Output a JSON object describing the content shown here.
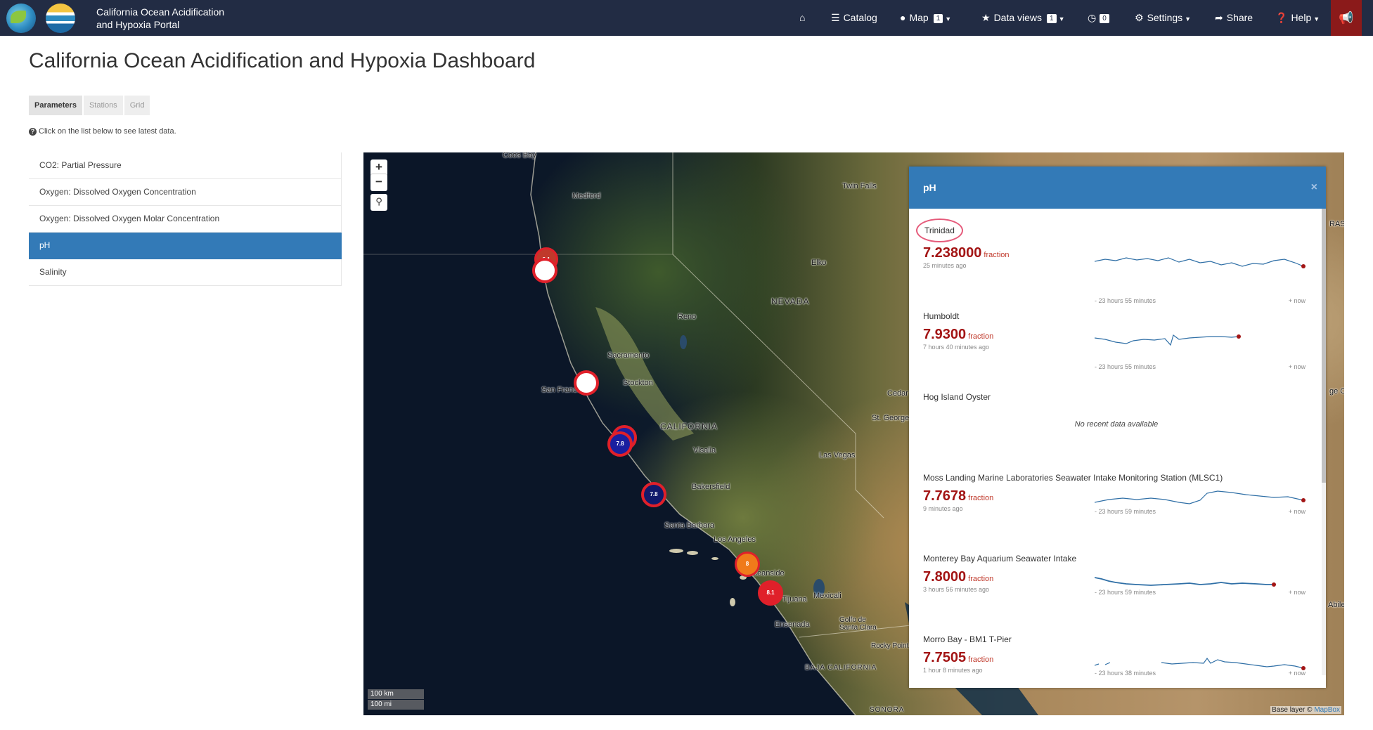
{
  "navbar": {
    "brand_line1": "California Ocean Acidification",
    "brand_line2": "and Hypoxia Portal",
    "catalog": "Catalog",
    "map": "Map",
    "map_count": "1",
    "data_views": "Data views",
    "data_views_count": "1",
    "timeseries_count": "0",
    "settings": "Settings",
    "share": "Share",
    "help": "Help",
    "icons": [
      "home-icon",
      "list-icon",
      "globe-icon",
      "star-icon",
      "clock-icon",
      "gear-icon",
      "share-icon",
      "question-icon",
      "megaphone-icon"
    ]
  },
  "page": {
    "title": "California Ocean Acidification and Hypoxia Dashboard",
    "tabs": [
      "Parameters",
      "Stations",
      "Grid"
    ],
    "hint": "Click on the list below to see latest data."
  },
  "parameters": [
    "CO2: Partial Pressure",
    "Oxygen: Dissolved Oxygen Concentration",
    "Oxygen: Dissolved Oxygen Molar Concentration",
    "pH",
    "Salinity"
  ],
  "map": {
    "places": [
      "Coos Bay",
      "Medford",
      "Twin Falls",
      "Elko",
      "NEVADA",
      "Reno",
      "Sacramento",
      "Stockton",
      "San Francisco",
      "CALIFORNIA",
      "Visalia",
      "Bakersfield",
      "Las Vegas",
      "St. George",
      "Santa Barbara",
      "Los Angeles",
      "Oceanside",
      "Tijuana",
      "Mexicali",
      "Ensenada",
      "Golfo de Santa Clara",
      "Rocky Point",
      "BAJA CALIFORNIA",
      "SONORA",
      "Cedar",
      "Abile",
      "ge Ci",
      "RAS"
    ],
    "markers": [
      "8.1",
      "7.8",
      "7.8",
      "8",
      "8.1"
    ],
    "scale_km": "100 km",
    "scale_mi": "100 mi",
    "attribution_prefix": "Base layer © ",
    "attribution_link": "MapBox"
  },
  "panel": {
    "title": "pH",
    "stations": [
      {
        "name": "Trinidad",
        "value": "7.238000",
        "unit": "fraction",
        "ago": "25 minutes ago",
        "range_start": "- 23 hours 55 minutes",
        "range_end": "+ now"
      },
      {
        "name": "Humboldt",
        "value": "7.9300",
        "unit": "fraction",
        "ago": "7 hours 40 minutes ago",
        "range_start": "- 23 hours 55 minutes",
        "range_end": "+ now"
      },
      {
        "name": "Hog Island Oyster",
        "no_data": "No recent data available"
      },
      {
        "name": "Moss Landing Marine Laboratories Seawater Intake Monitoring Station (MLSC1)",
        "value": "7.7678",
        "unit": "fraction",
        "ago": "9 minutes ago",
        "range_start": "- 23 hours 59 minutes",
        "range_end": "+ now"
      },
      {
        "name": "Monterey Bay Aquarium Seawater Intake",
        "value": "7.8000",
        "unit": "fraction",
        "ago": "3 hours 56 minutes ago",
        "range_start": "- 23 hours 59 minutes",
        "range_end": "+ now"
      },
      {
        "name": "Morro Bay - BM1 T-Pier",
        "value": "7.7505",
        "unit": "fraction",
        "ago": "1 hour 8 minutes ago",
        "range_start": "- 23 hours 38 minutes",
        "range_end": "+ now"
      }
    ]
  },
  "colors": {
    "navbar": "#222c44",
    "accent": "#337ab7",
    "value_red": "#a31515",
    "spark_line": "#2f6fa6",
    "alert": "#8b1a1a"
  }
}
